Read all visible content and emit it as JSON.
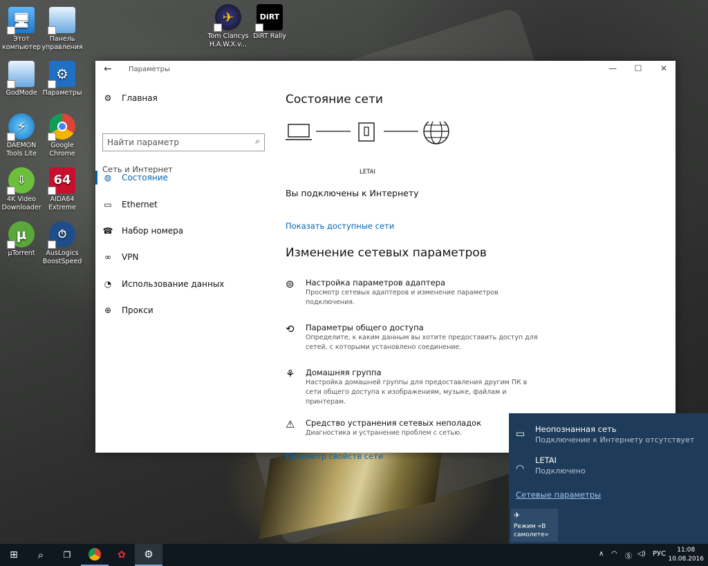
{
  "desktop": {
    "icons": [
      {
        "label": "Этот компьютер"
      },
      {
        "label": "Панель управления"
      },
      {
        "label": "Tom Clancys H.A.W.X.v..."
      },
      {
        "label": "DiRT Rally"
      },
      {
        "label": "GodMode"
      },
      {
        "label": "Параметры"
      },
      {
        "label": "DAEMON Tools Lite"
      },
      {
        "label": "Google Chrome"
      },
      {
        "label": "4K Video Downloader"
      },
      {
        "label": "AIDA64 Extreme"
      },
      {
        "label": "µTorrent"
      },
      {
        "label": "AusLogics BoostSpeed"
      }
    ]
  },
  "window": {
    "title": "Параметры",
    "back_glyph": "←",
    "minimize_glyph": "—",
    "maximize_glyph": "☐",
    "close_glyph": "✕",
    "nav": {
      "home": "Главная",
      "search_placeholder": "Найти параметр",
      "section": "Сеть и Интернет",
      "items": [
        {
          "label": "Состояние",
          "icon": "globe-icon"
        },
        {
          "label": "Ethernet",
          "icon": "ethernet-icon"
        },
        {
          "label": "Набор номера",
          "icon": "dialup-icon"
        },
        {
          "label": "VPN",
          "icon": "vpn-icon"
        },
        {
          "label": "Использование данных",
          "icon": "data-usage-icon"
        },
        {
          "label": "Прокси",
          "icon": "globe-icon"
        }
      ]
    },
    "main": {
      "status_heading": "Состояние сети",
      "network_name": "LETAI",
      "connected_text": "Вы подключены к Интернету",
      "show_networks_link": "Показать доступные сети",
      "change_heading": "Изменение сетевых параметров",
      "items": [
        {
          "title": "Настройка параметров адаптера",
          "desc": "Просмотр сетевых адаптеров и изменение параметров подключения."
        },
        {
          "title": "Параметры общего доступа",
          "desc": "Определите, к каким данным вы хотите предоставить доступ для сетей, с которыми установлено соединение."
        },
        {
          "title": "Домашняя группа",
          "desc": "Настройка домашней группы для предоставления другим ПК в сети общего доступа к изображениям, музыке, файлам и принтерам."
        },
        {
          "title": "Средство устранения сетевых неполадок",
          "desc": "Диагностика и устранение проблем с сетью."
        }
      ],
      "view_props_link": "Просмотр свойств сети"
    }
  },
  "flyout": {
    "networks": [
      {
        "name": "Неопознанная сеть",
        "status": "Подключение к Интернету отсутствует"
      },
      {
        "name": "LETAI",
        "status": "Подключено"
      }
    ],
    "settings_link": "Сетевые параметры",
    "airplane_label": "Режим «В самолете»"
  },
  "taskbar": {
    "lang": "РУС",
    "time": "11:08",
    "date": "10.08.2016"
  },
  "colors": {
    "accent": "#0063b1",
    "flyout_bg": "#1f3b5a",
    "taskbar_bg": "#10181f"
  }
}
